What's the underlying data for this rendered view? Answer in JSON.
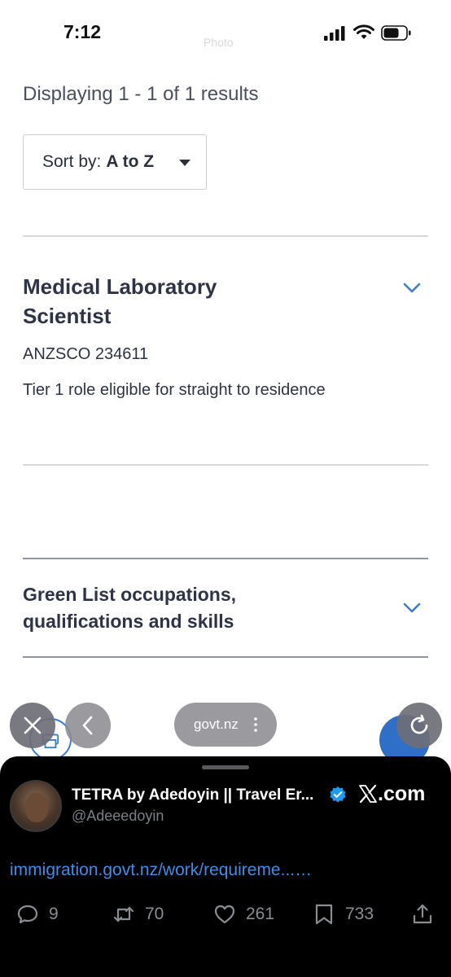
{
  "status_bar": {
    "time": "7:12",
    "center_text": "Photo"
  },
  "page": {
    "results_text": "Displaying 1 - 1 of 1 results",
    "sort": {
      "label": "Sort by:",
      "value": "A to Z"
    },
    "occupation": {
      "title": "Medical Laboratory Scientist",
      "code": "ANZSCO 234611",
      "description": "Tier 1 role eligible for straight to residence"
    },
    "green_list": {
      "title": "Green List occupations, qualifications and skills"
    }
  },
  "browser": {
    "url": "govt.nz"
  },
  "tweet": {
    "display_name": "TETRA by Adedoyin || Travel Er...",
    "handle": "@Adeeedoyin",
    "brand": ".com",
    "link_text": "immigration.govt.nz/work/requireme...…",
    "actions": {
      "replies": "9",
      "retweets": "70",
      "likes": "261",
      "bookmarks": "733"
    }
  },
  "colors": {
    "accent_blue": "#2f6fc7",
    "link_blue": "#3a8fe8",
    "heading": "#2e3445"
  }
}
